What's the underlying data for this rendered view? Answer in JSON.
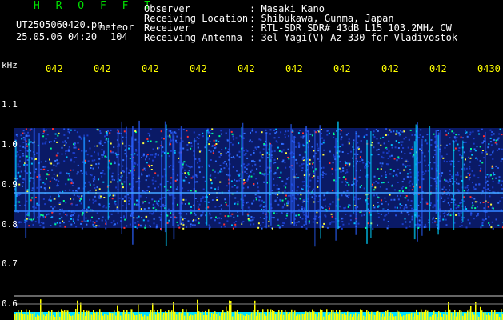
{
  "header": {
    "brand": "H R O F F T",
    "filename": "UT2505060420.pn",
    "meteor_label": "meteor",
    "datetime": "25.05.06 04:20",
    "count": "104",
    "meta": [
      {
        "label": "Observer",
        "value": ": Masaki Kano"
      },
      {
        "label": "Receiving Location",
        "value": ": Shibukawa, Gunma, Japan"
      },
      {
        "label": "Receiver",
        "value": ": RTL-SDR SDR# 43dB L15 103.2MHz CW"
      },
      {
        "label": "Receiving Antenna",
        "value": ": 3el Yagi(V) Az 330 for Vladivostok"
      }
    ]
  },
  "plot": {
    "y_unit": "kHz",
    "y_ticks": [
      "1.1",
      "1.0",
      "0.9",
      "0.8",
      "0.7",
      "0.6"
    ],
    "x_ticks": [
      "042",
      "042",
      "042",
      "042",
      "042",
      "042",
      "042",
      "042",
      "042",
      "0430"
    ],
    "colors": {
      "background": "#000000",
      "signal_blue": "#1a3cc8",
      "axis_text": "#ffffff",
      "time_text": "#ffff00",
      "histogram": "#ffff00",
      "histogram_base": "#00e0ff"
    }
  }
}
